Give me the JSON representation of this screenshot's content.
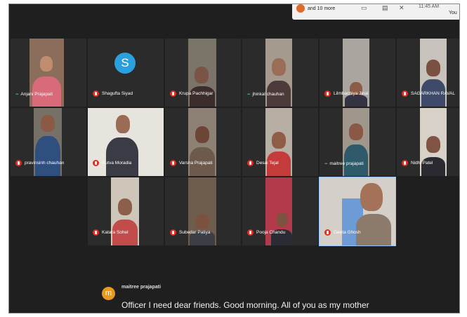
{
  "top_bar": {
    "more_text": "and 10 more",
    "time": "11:45 AM",
    "self_label": "You"
  },
  "participants": [
    {
      "name": "Anjani Prajapati",
      "mic": "active"
    },
    {
      "name": "Shagufta Siyad",
      "mic": "muted",
      "avatar_letter": "S"
    },
    {
      "name": "Krupa Pachhigar",
      "mic": "muted"
    },
    {
      "name": "jhinkal chauhan",
      "mic": "active"
    },
    {
      "name": "Lilmbachiya Jinal",
      "mic": "muted"
    },
    {
      "name": "SAGARKHAN RAVAL",
      "mic": "muted"
    },
    {
      "name": "pravinsinh chauhan",
      "mic": "muted"
    },
    {
      "name": "Rutva Moradia",
      "mic": "muted"
    },
    {
      "name": "Varsha Prajapati",
      "mic": "muted"
    },
    {
      "name": "Desai Tejal",
      "mic": "muted"
    },
    {
      "name": "maitree prajapati",
      "mic": "speaking"
    },
    {
      "name": "Nidhi Patel",
      "mic": "muted"
    },
    {
      "name": "Katara Sohel",
      "mic": "muted"
    },
    {
      "name": "Subedar Patiya",
      "mic": "muted"
    },
    {
      "name": "Pooja Chandu",
      "mic": "muted"
    },
    {
      "name": "Geeta Ghosh",
      "mic": "muted"
    }
  ],
  "caption": {
    "speaker_initial": "m",
    "speaker": "maitree prajapati",
    "text": "Officer I need dear friends. Good morning. All of you as my mother"
  },
  "colors": {
    "background": "#1f1f1f",
    "tile": "#2b2b2b",
    "mic_muted": "#d93025",
    "mic_active": "#34a853",
    "avatar_blue": "#2aa1de",
    "caption_avatar": "#e89a1c"
  }
}
